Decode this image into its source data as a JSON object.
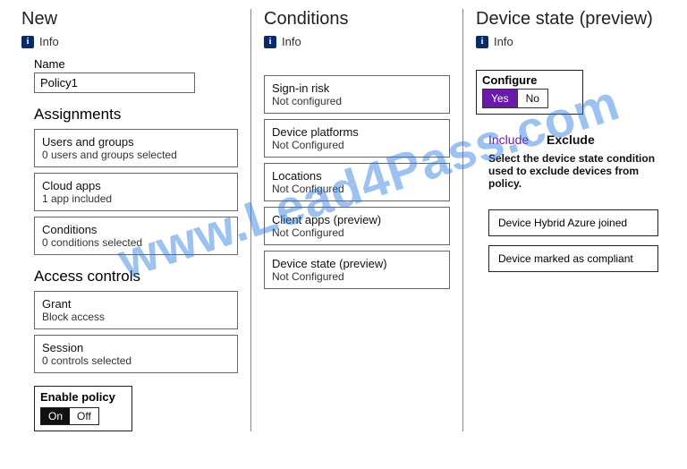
{
  "watermark": "www.Lead4Pass.com",
  "col1": {
    "title": "New",
    "info": "Info",
    "name_label": "Name",
    "name_value": "Policy1",
    "assignments_head": "Assignments",
    "assignments": [
      {
        "title": "Users and groups",
        "sub": "0 users and groups selected"
      },
      {
        "title": "Cloud apps",
        "sub": "1 app included"
      },
      {
        "title": "Conditions",
        "sub": "0 conditions selected"
      }
    ],
    "access_head": "Access controls",
    "access": [
      {
        "title": "Grant",
        "sub": "Block access"
      },
      {
        "title": "Session",
        "sub": "0 controls selected"
      }
    ],
    "enable_label": "Enable policy",
    "toggle_on": "On",
    "toggle_off": "Off"
  },
  "col2": {
    "title": "Conditions",
    "info": "Info",
    "items": [
      {
        "title": "Sign-in risk",
        "sub": "Not configured"
      },
      {
        "title": "Device platforms",
        "sub": "Not Configured"
      },
      {
        "title": "Locations",
        "sub": "Not Configured"
      },
      {
        "title": "Client apps (preview)",
        "sub": "Not Configured"
      },
      {
        "title": "Device state (preview)",
        "sub": "Not Configured"
      }
    ]
  },
  "col3": {
    "title": "Device state (preview)",
    "info": "Info",
    "configure_label": "Configure",
    "yes": "Yes",
    "no": "No",
    "tab_include": "Include",
    "tab_exclude": "Exclude",
    "helper": "Select the device state condition used to exclude devices from policy.",
    "choices": [
      "Device Hybrid Azure joined",
      "Device marked as compliant"
    ]
  }
}
